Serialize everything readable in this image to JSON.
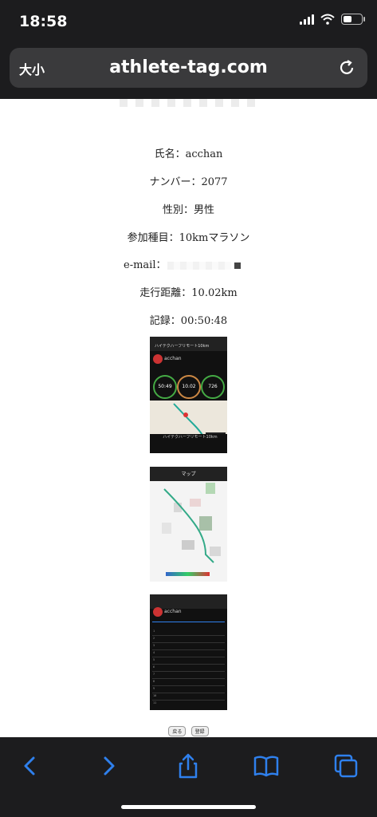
{
  "status_bar": {
    "time": "18:58"
  },
  "browser": {
    "text_size_label": "大小",
    "url": "athlete-tag.com"
  },
  "runner_info": {
    "name": "氏名：acchan",
    "number": "ナンバー：2077",
    "gender": "性別：男性",
    "event": "参加種目：10kmマラソン",
    "email_label": "e-mail：",
    "distance": "走行距離：10.02km",
    "record": "記録：00:50:48"
  },
  "screenshot1": {
    "title": "ハイテクハーフリモート10km",
    "user": "acchan",
    "time_value": "50:49",
    "distance_value": "10.02",
    "calorie_value": "726",
    "footer_text": "ハイテクハーフリモート10km"
  },
  "screenshot2": {
    "header": "マップ"
  },
  "screenshot3": {
    "user": "acchan",
    "rows": [
      "1",
      "2",
      "3",
      "4",
      "5",
      "6",
      "7",
      "8",
      "9",
      "10",
      "11"
    ]
  },
  "form_buttons": {
    "back": "戻る",
    "submit": "登録"
  },
  "colors": {
    "chrome": "#1c1c1e",
    "accent": "#2f80ed"
  }
}
